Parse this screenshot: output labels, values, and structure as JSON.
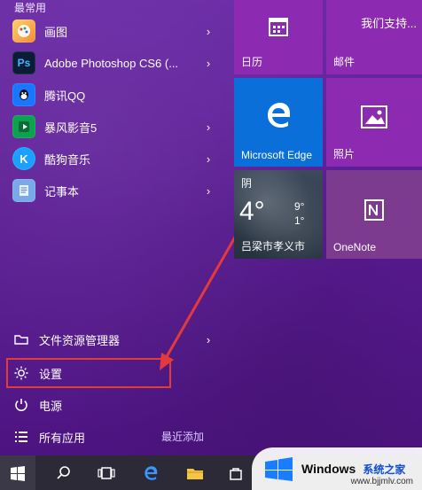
{
  "start_menu": {
    "section_header": "最常用",
    "most_used": [
      {
        "label": "画图",
        "icon": "paint-icon"
      },
      {
        "label": "Adobe Photoshop CS6 (...",
        "icon": "photoshop-icon"
      },
      {
        "label": "腾讯QQ",
        "icon": "qq-icon"
      },
      {
        "label": "暴风影音5",
        "icon": "video-player-icon"
      },
      {
        "label": "酷狗音乐",
        "icon": "music-icon"
      },
      {
        "label": "记事本",
        "icon": "notepad-icon"
      }
    ],
    "system_items": [
      {
        "label": "文件资源管理器",
        "icon": "folder-explorer-icon"
      },
      {
        "label": "设置",
        "icon": "gear-icon"
      },
      {
        "label": "电源",
        "icon": "power-icon"
      },
      {
        "label": "所有应用",
        "icon": "all-apps-icon"
      }
    ],
    "recent_label": "最近添加"
  },
  "tiles": {
    "calendar": {
      "label": "日历"
    },
    "mail": {
      "label": "邮件",
      "subtitle": "我们支持..."
    },
    "edge": {
      "label": "Microsoft Edge"
    },
    "photos": {
      "label": "照片"
    },
    "weather": {
      "condition": "阴",
      "temp": "4°",
      "high": "9°",
      "low": "1°",
      "location": "吕梁市孝义市"
    },
    "onenote": {
      "label": "OneNote"
    }
  },
  "taskbar": {
    "items": [
      "windows-start-icon",
      "search-icon",
      "task-view-icon",
      "edge-icon",
      "file-explorer-icon",
      "store-icon"
    ]
  },
  "watermark": {
    "brand": "Windows",
    "cn": "系统之家",
    "url": "www.bjjmlv.com"
  },
  "colors": {
    "accent": "#8c2bb1",
    "edge_tile": "#0a6fd8",
    "highlight": "#e33b3b",
    "taskbar": "#2b2a36"
  }
}
